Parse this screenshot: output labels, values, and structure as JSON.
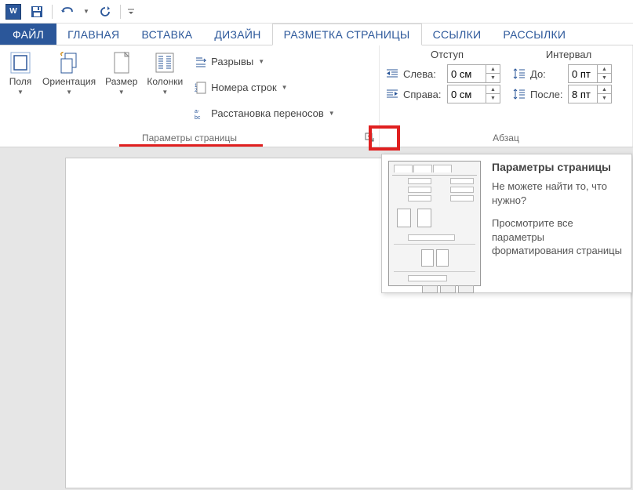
{
  "qat": {
    "word_badge": "W"
  },
  "tabs": {
    "file": "ФАЙЛ",
    "home": "ГЛАВНАЯ",
    "insert": "ВСТАВКА",
    "design": "ДИЗАЙН",
    "page_layout": "РАЗМЕТКА СТРАНИЦЫ",
    "references": "ССЫЛКИ",
    "mailings": "РАССЫЛКИ"
  },
  "ribbon": {
    "page_setup": {
      "margins": "Поля",
      "orientation": "Ориентация",
      "size": "Размер",
      "columns": "Колонки",
      "breaks": "Разрывы",
      "line_numbers": "Номера строк",
      "hyphenation": "Расстановка переносов",
      "group_label": "Параметры страницы"
    },
    "paragraph": {
      "indent_header": "Отступ",
      "spacing_header": "Интервал",
      "left_label": "Слева:",
      "right_label": "Справа:",
      "before_label": "До:",
      "after_label": "После:",
      "left_value": "0 см",
      "right_value": "0 см",
      "before_value": "0 пт",
      "after_value": "8 пт",
      "group_label": "Абзац"
    }
  },
  "tooltip": {
    "title": "Параметры страницы",
    "line1": "Не можете найти то, что нужно?",
    "line2": "Просмотрите все параметры форматирования страницы"
  }
}
